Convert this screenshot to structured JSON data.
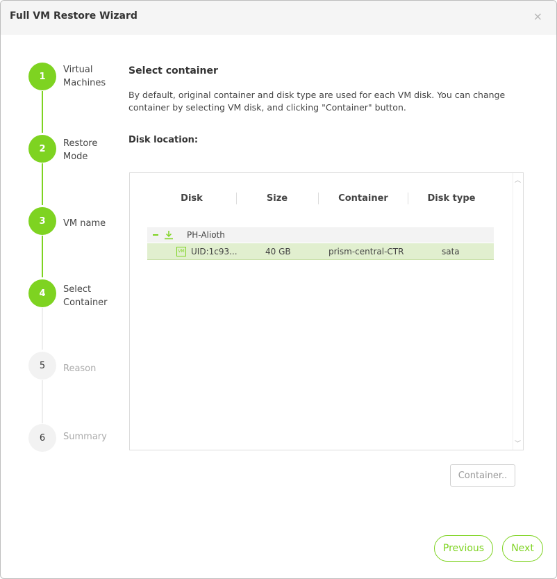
{
  "dialog": {
    "title": "Full VM Restore Wizard",
    "close_glyph": "×"
  },
  "steps": [
    {
      "number": "1",
      "label": "Virtual\nMachines",
      "state": "complete"
    },
    {
      "number": "2",
      "label": "Restore\nMode",
      "state": "complete"
    },
    {
      "number": "3",
      "label": "VM name",
      "state": "complete"
    },
    {
      "number": "4",
      "label": "Select\nContainer",
      "state": "current"
    },
    {
      "number": "5",
      "label": "Reason",
      "state": "pending"
    },
    {
      "number": "6",
      "label": "Summary",
      "state": "pending"
    }
  ],
  "main": {
    "heading": "Select container",
    "description": "By default, original container and disk type are used for each VM disk. You can change container by selecting VM disk, and clicking \"Container\" button.",
    "disk_location_label": "Disk location:"
  },
  "table": {
    "columns": [
      "Disk",
      "Size",
      "Container",
      "Disk type"
    ],
    "group": {
      "label": "PH-Alioth",
      "icon": "download-icon"
    },
    "rows": [
      {
        "icon": "VM",
        "disk": "UID:1c93...",
        "size": "40 GB",
        "container": "prism-central-CTR",
        "disk_type": "sata",
        "selected": true
      }
    ]
  },
  "buttons": {
    "container": "Container..",
    "previous": "Previous",
    "next": "Next"
  },
  "colors": {
    "accent": "#7ed321",
    "selected_row": "#e1efcf",
    "inactive_step": "#f2f2f2"
  }
}
